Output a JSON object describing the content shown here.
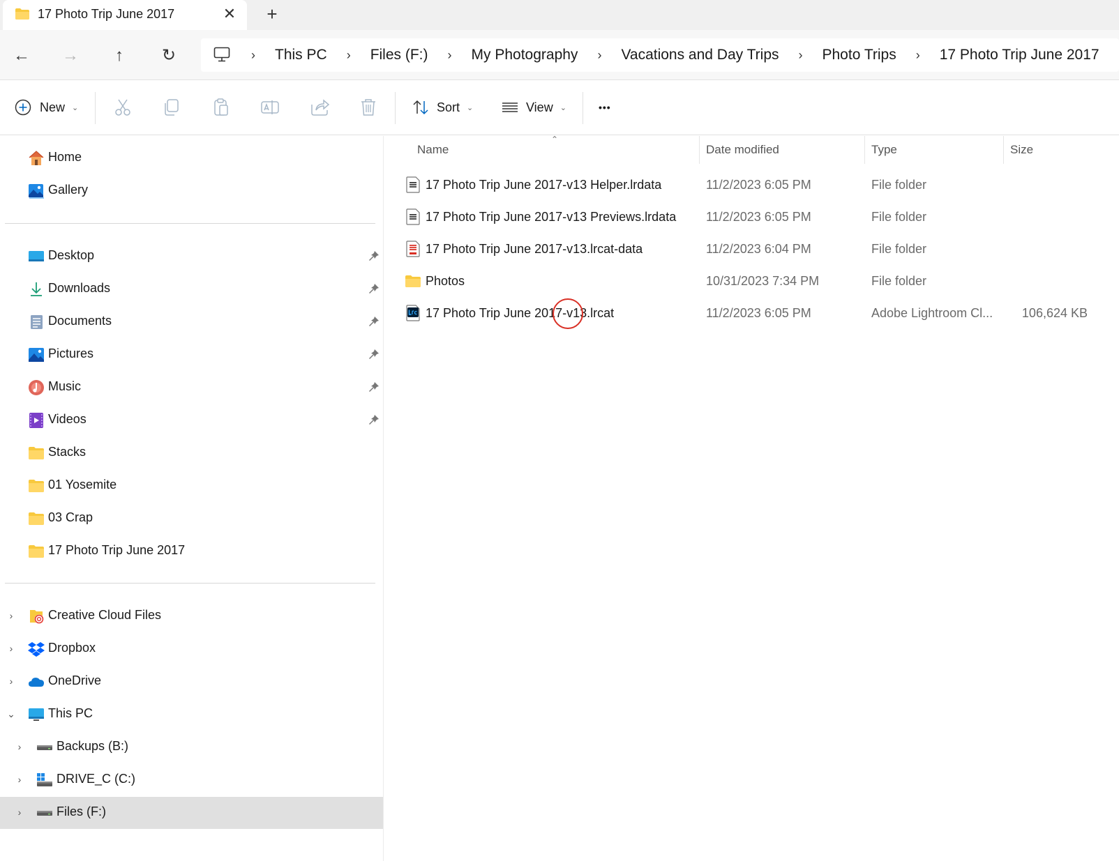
{
  "tab": {
    "title": "17 Photo Trip June 2017",
    "close_glyph": "✕",
    "new_glyph": "+"
  },
  "nav": {
    "back_glyph": "←",
    "forward_glyph": "→",
    "up_glyph": "↑",
    "refresh_glyph": "↻"
  },
  "breadcrumb": [
    "This PC",
    "Files (F:)",
    "My Photography",
    "Vacations and Day Trips",
    "Photo Trips",
    "17 Photo Trip June 2017"
  ],
  "breadcrumb_sep": "›",
  "toolbar": {
    "new_label": "New",
    "sort_label": "Sort",
    "view_label": "View",
    "more_glyph": "•••",
    "chevron": "⌄"
  },
  "sidebar": {
    "quick": [
      {
        "label": "Home",
        "icon": "home-icon"
      },
      {
        "label": "Gallery",
        "icon": "gallery-icon"
      }
    ],
    "pinned": [
      {
        "label": "Desktop",
        "icon": "desktop-icon",
        "pinned": true
      },
      {
        "label": "Downloads",
        "icon": "downloads-icon",
        "pinned": true
      },
      {
        "label": "Documents",
        "icon": "documents-icon",
        "pinned": true
      },
      {
        "label": "Pictures",
        "icon": "pictures-icon",
        "pinned": true
      },
      {
        "label": "Music",
        "icon": "music-icon",
        "pinned": true
      },
      {
        "label": "Videos",
        "icon": "videos-icon",
        "pinned": true
      },
      {
        "label": "Stacks",
        "icon": "folder-icon",
        "pinned": false
      },
      {
        "label": "01 Yosemite",
        "icon": "folder-icon",
        "pinned": false
      },
      {
        "label": "03 Crap",
        "icon": "folder-icon",
        "pinned": false
      },
      {
        "label": "17 Photo Trip June 2017",
        "icon": "folder-icon",
        "pinned": false
      }
    ],
    "locations": [
      {
        "label": "Creative Cloud Files",
        "icon": "creative-cloud-icon",
        "expanded": false
      },
      {
        "label": "Dropbox",
        "icon": "dropbox-icon",
        "expanded": false
      },
      {
        "label": "OneDrive",
        "icon": "onedrive-icon",
        "expanded": false
      },
      {
        "label": "This PC",
        "icon": "pc-icon",
        "expanded": true
      }
    ],
    "drives": [
      {
        "label": "Backups (B:)",
        "icon": "drive-icon",
        "selected": false
      },
      {
        "label": "DRIVE_C (C:)",
        "icon": "windows-drive-icon",
        "selected": false
      },
      {
        "label": "Files (F:)",
        "icon": "drive-icon",
        "selected": true
      }
    ],
    "expand_glyph": "›",
    "collapse_glyph": "⌄"
  },
  "columns": {
    "name": "Name",
    "date": "Date modified",
    "type": "Type",
    "size": "Size",
    "sort_glyph": "⌃"
  },
  "files": [
    {
      "name": "17 Photo Trip June 2017-v13 Helper.lrdata",
      "date": "11/2/2023 6:05 PM",
      "type": "File folder",
      "size": "",
      "icon": "lrdata-icon"
    },
    {
      "name": "17 Photo Trip June 2017-v13 Previews.lrdata",
      "date": "11/2/2023 6:05 PM",
      "type": "File folder",
      "size": "",
      "icon": "lrdata-icon"
    },
    {
      "name": "17 Photo Trip June 2017-v13.lrcat-data",
      "date": "11/2/2023 6:04 PM",
      "type": "File folder",
      "size": "",
      "icon": "lrcat-data-icon"
    },
    {
      "name": "Photos",
      "date": "10/31/2023 7:34 PM",
      "type": "File folder",
      "size": "",
      "icon": "folder-icon"
    },
    {
      "name": "17 Photo Trip June 2017-v13.lrcat",
      "date": "11/2/2023 6:05 PM",
      "type": "Adobe Lightroom Cl...",
      "size": "106,624 KB",
      "icon": "lightroom-icon"
    }
  ],
  "colors": {
    "folder": "#F8C93E",
    "accent": "#0067C0",
    "annotation": "#D93025",
    "selected_bg": "#E0E0E0"
  }
}
